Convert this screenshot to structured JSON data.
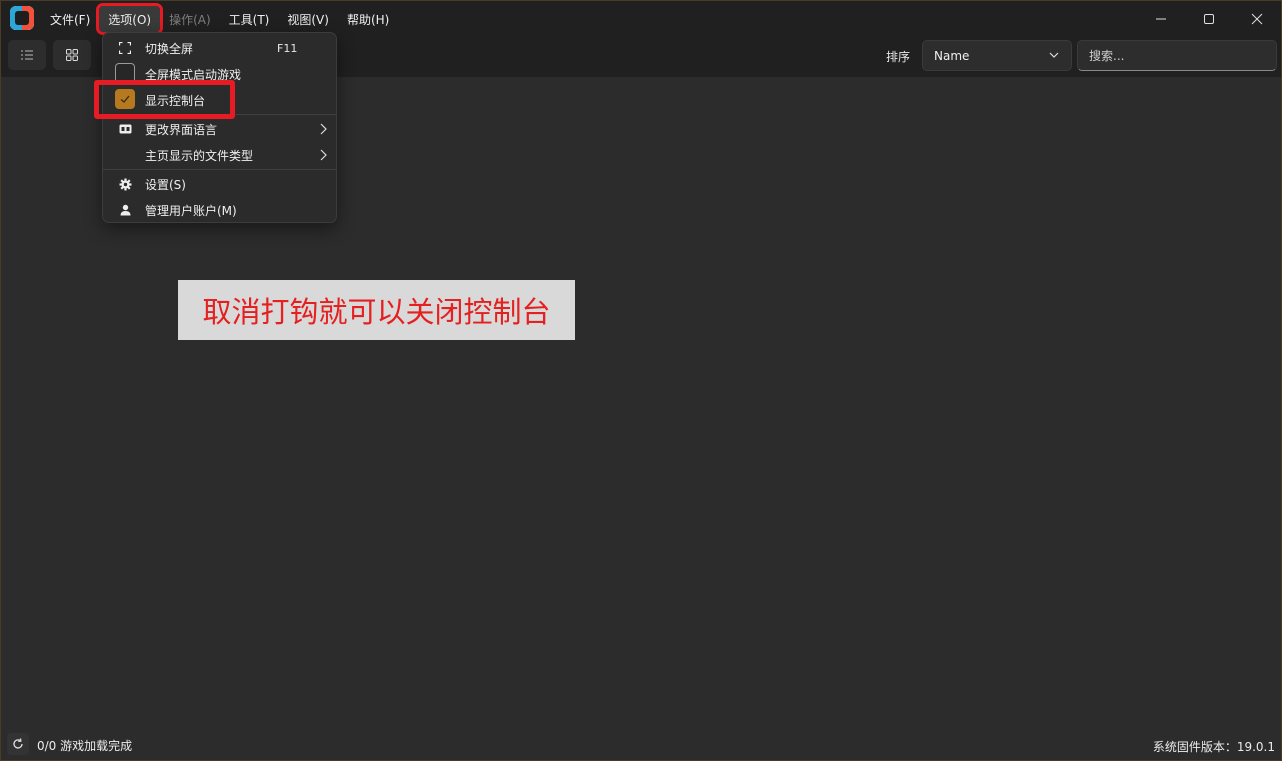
{
  "menubar": {
    "items": [
      {
        "label": "文件(F)"
      },
      {
        "label": "选项(O)"
      },
      {
        "label": "操作(A)"
      },
      {
        "label": "工具(T)"
      },
      {
        "label": "视图(V)"
      },
      {
        "label": "帮助(H)"
      }
    ]
  },
  "toolbar": {
    "sort_label": "排序",
    "sort_value": "Name",
    "search_placeholder": "搜索..."
  },
  "options_menu": {
    "items": [
      {
        "label": "切换全屏",
        "shortcut": "F11",
        "icon": "fullscreen-icon"
      },
      {
        "label": "全屏模式启动游戏",
        "checked": false
      },
      {
        "label": "显示控制台",
        "checked": true
      },
      {
        "label": "更改界面语言",
        "icon": "language-icon"
      },
      {
        "label": "主页显示的文件类型"
      },
      {
        "label": "设置(S)",
        "icon": "gear-icon"
      },
      {
        "label": "管理用户账户(M)",
        "icon": "user-icon"
      }
    ]
  },
  "annotation": {
    "text": "取消打钩就可以关闭控制台"
  },
  "status": {
    "games_loaded": "0/0 游戏加载完成",
    "firmware_version": "系统固件版本：19.0.1"
  },
  "colors": {
    "accent_check": "#b7791f",
    "highlight": "#e61b23",
    "annotation_text": "#e42020"
  }
}
